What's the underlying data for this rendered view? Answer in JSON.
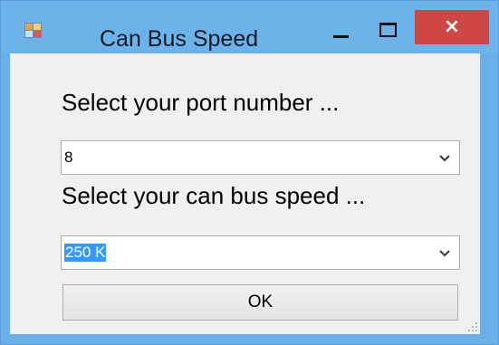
{
  "window": {
    "title": "Can Bus Speed",
    "close_glyph": "×",
    "icon": "app-window-icon",
    "accent_color": "#6cb3ea",
    "close_color": "#cf4744"
  },
  "form": {
    "port_label": "Select your port number ...",
    "port_value": "8",
    "speed_label": "Select your can bus speed ...",
    "speed_value": "250 K",
    "ok_label": "OK"
  }
}
